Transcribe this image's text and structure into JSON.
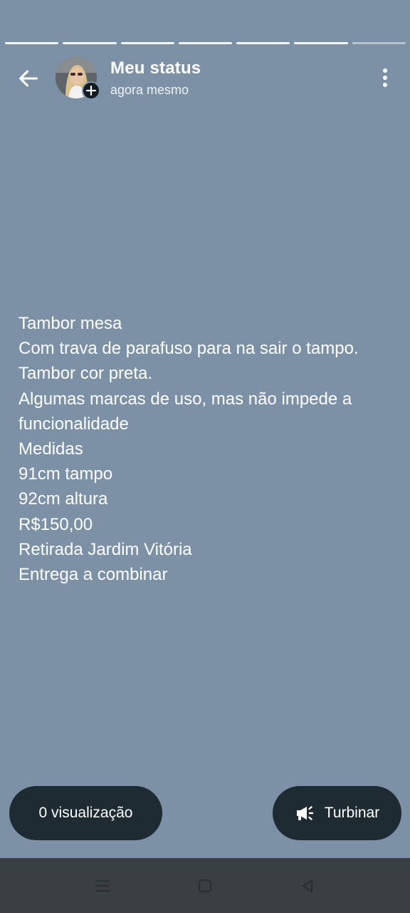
{
  "progress": {
    "segments_total": 7,
    "segments_complete": 6
  },
  "header": {
    "title": "Meu status",
    "subtitle": "agora mesmo"
  },
  "status": {
    "lines": [
      "Tambor mesa",
      "Com trava de parafuso para na sair o tampo.",
      "Tambor cor preta.",
      "Algumas marcas de uso, mas não impede a",
      "funcionalidade",
      "Medidas",
      "91cm tampo",
      "92cm altura",
      "R$150,00",
      "Retirada Jardim Vitória",
      "Entrega a combinar"
    ],
    "background_color": "#7d91a6"
  },
  "footer": {
    "views_label": "0 visualização",
    "boost_label": "Turbinar"
  },
  "icons": {
    "back": "arrow-left-icon",
    "menu": "more-vertical-icon",
    "add": "plus-icon",
    "boost": "megaphone-icon",
    "nav_recents": "menu-lines-icon",
    "nav_home": "square-icon",
    "nav_back": "triangle-back-icon"
  }
}
